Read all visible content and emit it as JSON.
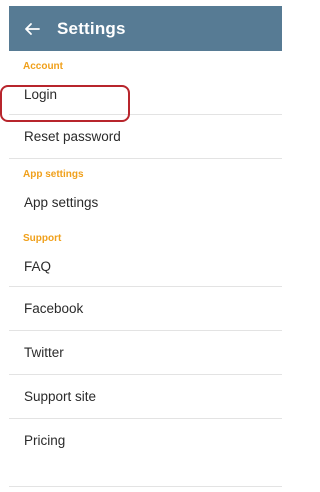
{
  "appbar": {
    "title": "Settings",
    "back_icon": "arrow-left-icon",
    "color": "#577b94"
  },
  "accent_color": "#f0a01b",
  "highlight_color": "#b8252c",
  "sections": {
    "account": {
      "header": "Account",
      "items": [
        "Login",
        "Reset password"
      ]
    },
    "app_settings": {
      "header": "App settings",
      "items": [
        "App settings"
      ]
    },
    "support": {
      "header": "Support",
      "items": [
        "FAQ",
        "Facebook",
        "Twitter",
        "Support site",
        "Pricing"
      ]
    }
  }
}
